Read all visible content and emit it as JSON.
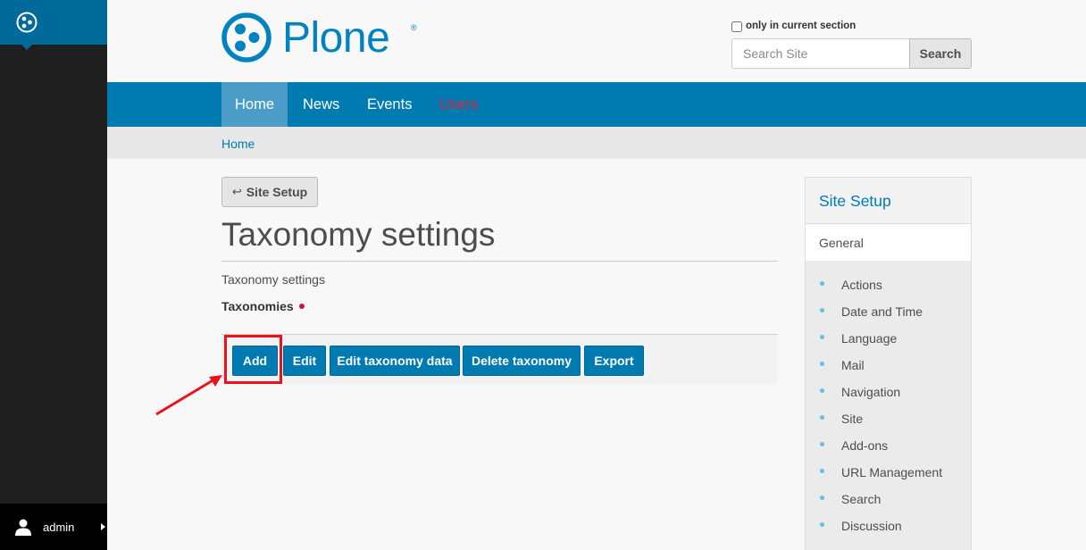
{
  "toolbar": {
    "user_name": "admin"
  },
  "header": {
    "logo_text": "Plone",
    "logo_reg": "®",
    "search_option_label": "only in current section",
    "search_placeholder": "Search Site",
    "search_button": "Search"
  },
  "nav": {
    "items": [
      {
        "label": "Home",
        "active": true
      },
      {
        "label": "News"
      },
      {
        "label": "Events"
      },
      {
        "label": "Users",
        "color": "#e0253a"
      }
    ]
  },
  "breadcrumb": {
    "home": "Home"
  },
  "main": {
    "back_button": "Site Setup",
    "back_arrow": "↩",
    "title": "Taxonomy settings",
    "description": "Taxonomy settings",
    "field_label": "Taxonomies",
    "buttons": [
      "Add",
      "Edit",
      "Edit taxonomy data",
      "Delete taxonomy",
      "Export"
    ]
  },
  "portlet": {
    "title": "Site Setup",
    "section": "General",
    "items": [
      "Actions",
      "Date and Time",
      "Language",
      "Mail",
      "Navigation",
      "Site",
      "Add-ons",
      "URL Management",
      "Search",
      "Discussion"
    ]
  },
  "colors": {
    "brand_blue": "#007bb1",
    "toolbar_dark": "#1f1f1f",
    "highlight_red": "#e8141a"
  }
}
